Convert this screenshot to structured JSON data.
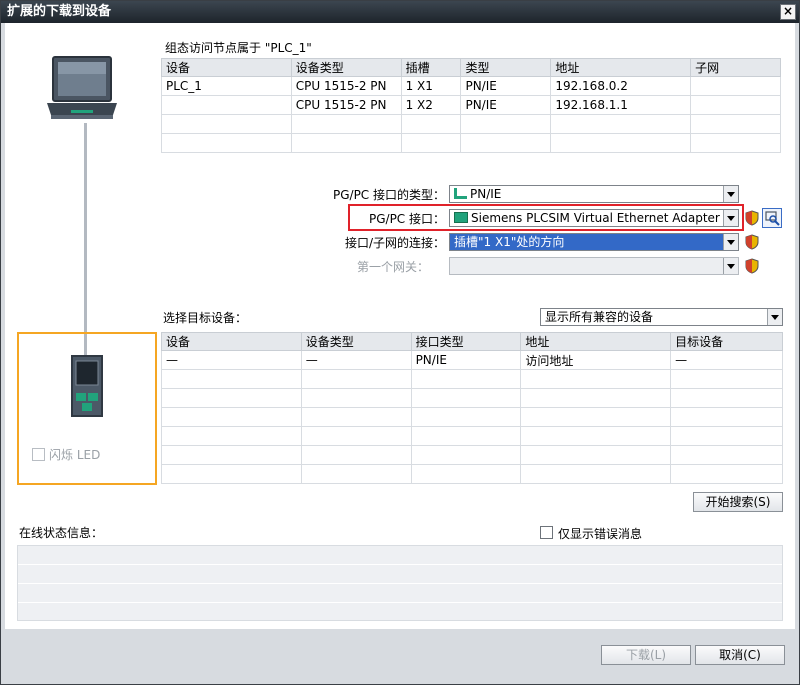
{
  "window": {
    "title": "扩展的下载到设备",
    "close_glyph": "×"
  },
  "nodes": {
    "caption": "组态访问节点属于 \"PLC_1\"",
    "columns": [
      "设备",
      "设备类型",
      "插槽",
      "类型",
      "地址",
      "子网"
    ],
    "rows": [
      [
        "PLC_1",
        "CPU 1515-2 PN",
        "1 X1",
        "PN/IE",
        "192.168.0.2",
        ""
      ],
      [
        "",
        "CPU 1515-2 PN",
        "1 X2",
        "PN/IE",
        "192.168.1.1",
        ""
      ]
    ]
  },
  "interface": {
    "type_label": "PG/PC 接口的类型：",
    "type_value": "PN/IE",
    "pgpc_label": "PG/PC 接口：",
    "pgpc_value": "Siemens PLCSIM Virtual Ethernet Adapter",
    "connection_label": "接口/子网的连接：",
    "connection_value": "插槽\"1 X1\"处的方向",
    "gateway_label": "第一个网关：",
    "gateway_value": ""
  },
  "target": {
    "caption": "选择目标设备：",
    "filter_value": "显示所有兼容的设备",
    "columns": [
      "设备",
      "设备类型",
      "接口类型",
      "地址",
      "目标设备"
    ],
    "rows": [
      [
        "—",
        "—",
        "PN/IE",
        "访问地址",
        "—"
      ]
    ],
    "search_button": "开始搜索(S)"
  },
  "device_panel": {
    "flash_led_label": "闪烁 LED"
  },
  "status": {
    "caption": "在线状态信息：",
    "errors_only_label": "仅显示错误消息"
  },
  "footer": {
    "download_button": "下载(L)",
    "cancel_button": "取消(C)"
  },
  "colors": {
    "title_bg": "#1d242b",
    "highlight_red": "#e0222a",
    "target_orange": "#f5a623",
    "selection_blue": "#3369c7"
  }
}
